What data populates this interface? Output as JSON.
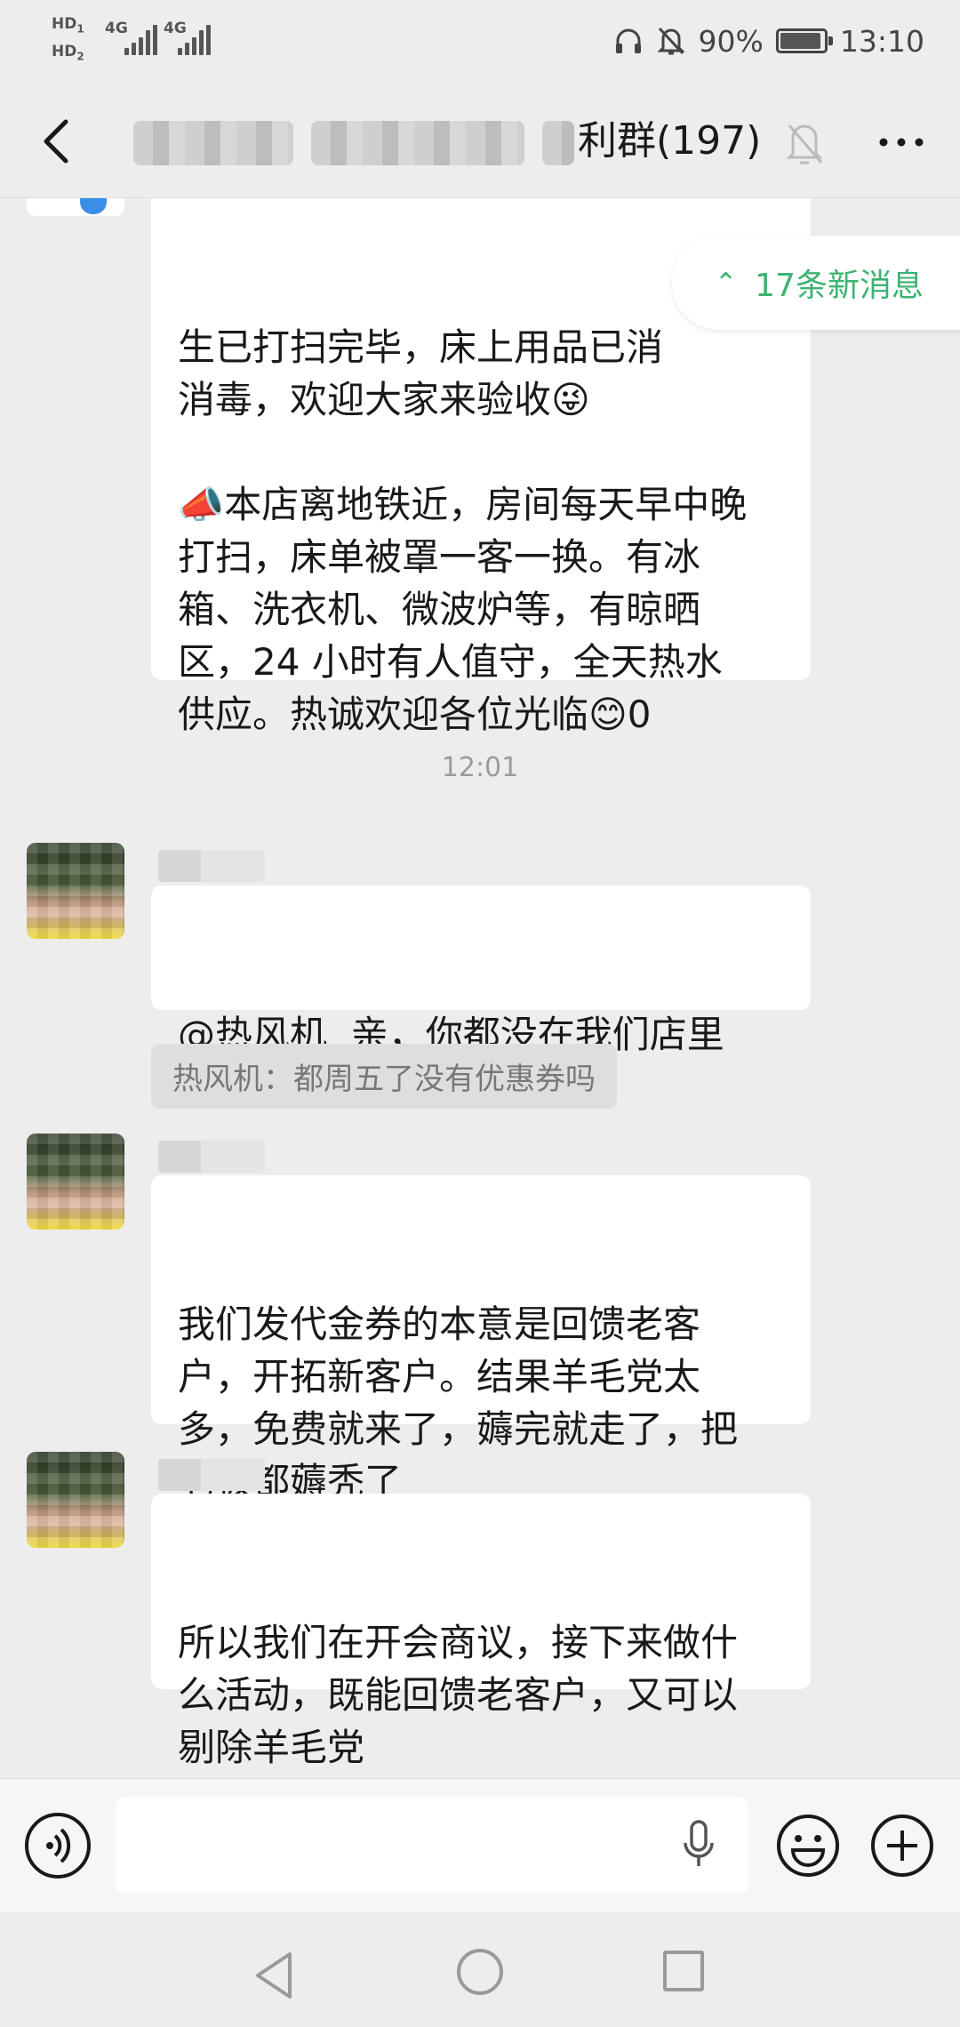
{
  "status_bar": {
    "hd1": "HD",
    "hd1_sub": "1",
    "hd2": "HD",
    "hd2_sub": "2",
    "net1": "4G",
    "net2": "4G",
    "battery_percent": "90%",
    "time": "13:10",
    "icons": [
      "headphones-icon",
      "mute-bell-icon",
      "battery-icon"
    ]
  },
  "header": {
    "title_visible": "利群(197)",
    "back_icon": "chevron-left-icon",
    "mute_icon": "muted-bell-icon",
    "more_icon": "more-dots-icon"
  },
  "new_messages": {
    "label": "17条新消息",
    "icon": "double-chevron-up-icon"
  },
  "messages": [
    {
      "id": "msg-1",
      "text": "生已打扫完毕，床上用品已消\n消毒，欢迎大家来验收😜\n\n📣本店离地铁近，房间每天早中晚\n打扫，床单被罩一客一换。有冰\n箱、洗衣机、微波炉等，有晾晒\n区，24 小时有人值守，全天热水\n供应。热诚欢迎各位光临😊0"
    },
    {
      "id": "msg-2",
      "text": "@热风机  亲，你都没在我们店里\n的嘛，天天问代金券😂"
    },
    {
      "id": "msg-3",
      "text": "我们发代金券的本意是回馈老客\n户，开拓新客户。结果羊毛党太\n多，免费就来了，薅完就走了，把\n老板都薅秃了"
    },
    {
      "id": "msg-4",
      "text": "所以我们在开会商议，接下来做什\n么活动，既能回馈老客户，又可以\n剔除羊毛党"
    }
  ],
  "timestamps": [
    "12:01"
  ],
  "quote": "热风机：都周五了没有优惠券吗",
  "input_bar": {
    "voice_icon": "voice-toggle-icon",
    "mic_icon": "microphone-icon",
    "emoji_icon": "emoji-icon",
    "plus_icon": "plus-icon"
  },
  "nav_bar": {
    "icons": [
      "nav-back-icon",
      "nav-home-icon",
      "nav-recent-icon"
    ]
  },
  "colors": {
    "background": "#ededed",
    "bubble": "#ffffff",
    "accent_green": "#3cb371",
    "text": "#191919",
    "muted": "#9b9b9b"
  }
}
